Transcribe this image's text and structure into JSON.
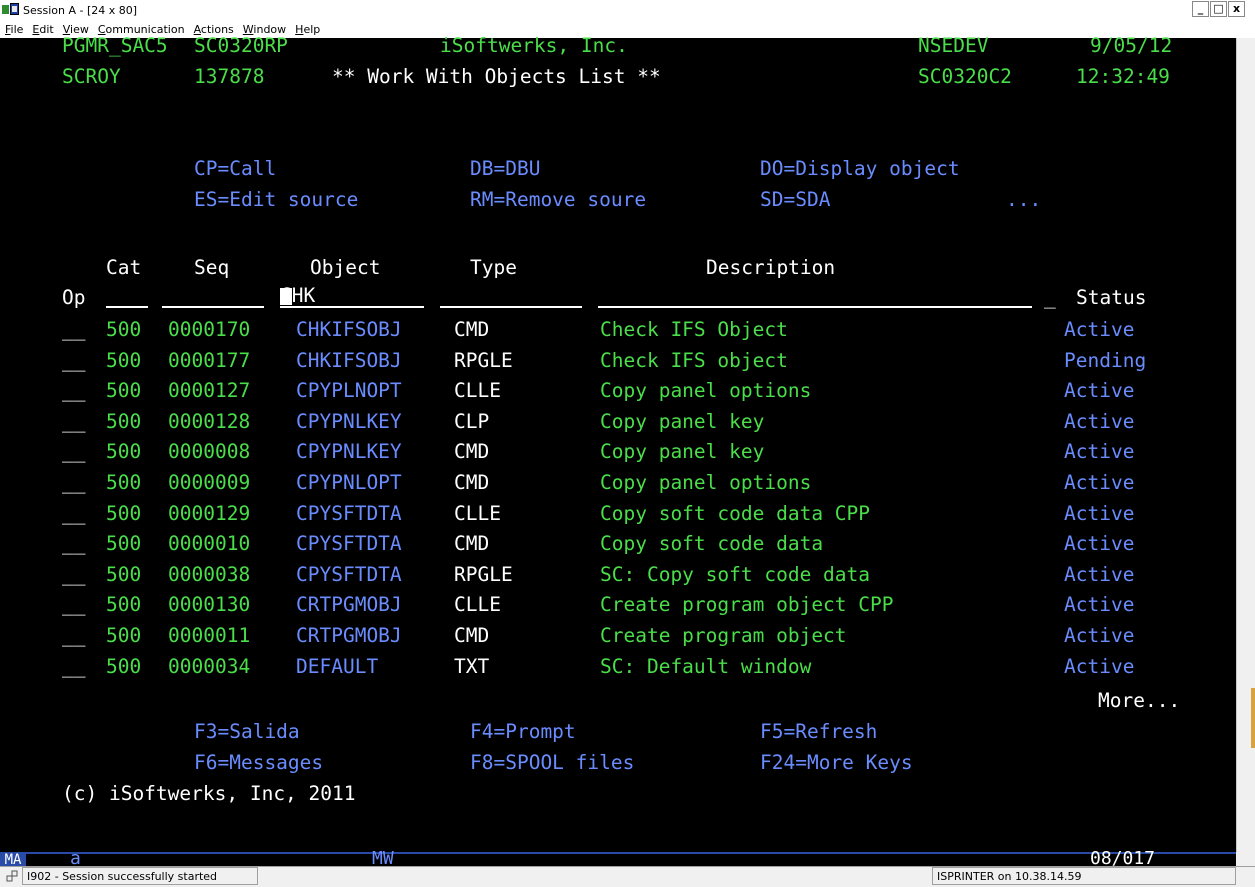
{
  "window": {
    "title": "Session A - [24 x 80]",
    "buttons": [
      "_",
      "□",
      "x"
    ]
  },
  "menu": [
    "File",
    "Edit",
    "View",
    "Communication",
    "Actions",
    "Window",
    "Help"
  ],
  "header": {
    "user": "PGMR_SAC5",
    "program": "SC0320RP",
    "company": "iSoftwerks, Inc.",
    "system": "NSEDEV",
    "date": "9/05/12",
    "user2": "SCROY",
    "job_number": "137878",
    "title": "** Work With Objects List **",
    "display_file": "SC0320C2",
    "time": "12:32:49"
  },
  "options": {
    "row1": [
      "CP=Call",
      "DB=DBU",
      "DO=Display object"
    ],
    "row2": [
      "ES=Edit source",
      "RM=Remove soure",
      "SD=SDA",
      "..."
    ]
  },
  "columns": {
    "op": "Op",
    "cat": "Cat",
    "seq": "Seq",
    "object": "Object",
    "type": "Type",
    "description": "Description",
    "status": "Status"
  },
  "filters": {
    "object_value": "CHK",
    "status_blank": "_"
  },
  "rows": [
    {
      "op": "__",
      "cat": "500",
      "seq": "0000170",
      "object": "CHKIFSOBJ",
      "type": "CMD",
      "description": "Check IFS Object",
      "status": "Active"
    },
    {
      "op": "__",
      "cat": "500",
      "seq": "0000177",
      "object": "CHKIFSOBJ",
      "type": "RPGLE",
      "description": "Check IFS object",
      "status": "Pending"
    },
    {
      "op": "__",
      "cat": "500",
      "seq": "0000127",
      "object": "CPYPLNOPT",
      "type": "CLLE",
      "description": "Copy panel options",
      "status": "Active"
    },
    {
      "op": "__",
      "cat": "500",
      "seq": "0000128",
      "object": "CPYPNLKEY",
      "type": "CLP",
      "description": "Copy panel key",
      "status": "Active"
    },
    {
      "op": "__",
      "cat": "500",
      "seq": "0000008",
      "object": "CPYPNLKEY",
      "type": "CMD",
      "description": "Copy panel key",
      "status": "Active"
    },
    {
      "op": "__",
      "cat": "500",
      "seq": "0000009",
      "object": "CPYPNLOPT",
      "type": "CMD",
      "description": "Copy panel options",
      "status": "Active"
    },
    {
      "op": "__",
      "cat": "500",
      "seq": "0000129",
      "object": "CPYSFTDTA",
      "type": "CLLE",
      "description": "Copy soft code data CPP",
      "status": "Active"
    },
    {
      "op": "__",
      "cat": "500",
      "seq": "0000010",
      "object": "CPYSFTDTA",
      "type": "CMD",
      "description": "Copy soft code data",
      "status": "Active"
    },
    {
      "op": "__",
      "cat": "500",
      "seq": "0000038",
      "object": "CPYSFTDTA",
      "type": "RPGLE",
      "description": "SC: Copy soft code data",
      "status": "Active"
    },
    {
      "op": "__",
      "cat": "500",
      "seq": "0000130",
      "object": "CRTPGMOBJ",
      "type": "CLLE",
      "description": "Create program object CPP",
      "status": "Active"
    },
    {
      "op": "__",
      "cat": "500",
      "seq": "0000011",
      "object": "CRTPGMOBJ",
      "type": "CMD",
      "description": "Create program object",
      "status": "Active"
    },
    {
      "op": "__",
      "cat": "500",
      "seq": "0000034",
      "object": "DEFAULT",
      "type": "TXT",
      "description": "SC: Default window",
      "status": "Active"
    }
  ],
  "more": "More...",
  "fkeys": {
    "row1": [
      "F3=Salida",
      "F4=Prompt",
      "F5=Refresh"
    ],
    "row2": [
      "F6=Messages",
      "F8=SPOOL files",
      "F24=More Keys"
    ]
  },
  "copyright": "(c) iSoftwerks, Inc, 2011",
  "oia": {
    "indicator": "MA",
    "a": "a",
    "mw": "MW",
    "cursor_pos": "08/017"
  },
  "statusbar": {
    "message": "I902 - Session successfully started",
    "printer": "ISPRINTER on 10.38.14.59"
  },
  "colors": {
    "green": "#4ade4a",
    "blue": "#6a8cff",
    "white": "#ffffff",
    "oia_blue": "#2a4aa8"
  }
}
